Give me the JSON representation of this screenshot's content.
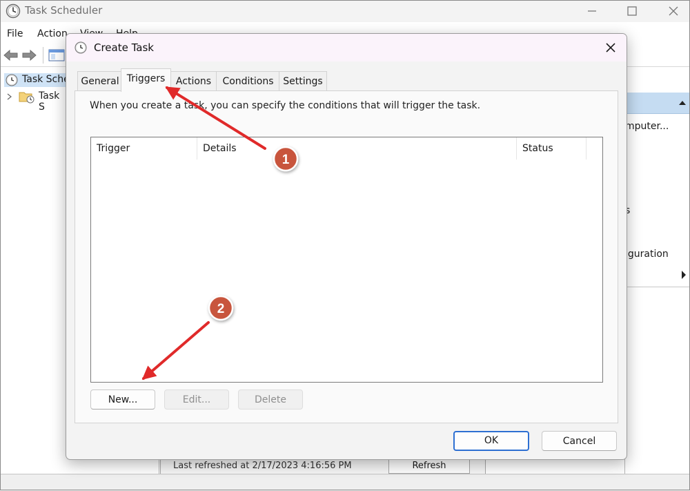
{
  "main_window": {
    "title": "Task Scheduler",
    "menu": {
      "file": "File",
      "action": "Action",
      "view": "View",
      "help": "Help"
    },
    "tree": {
      "root_label": "Task Sche",
      "child_label": "Task S"
    },
    "actions_panel": {
      "item_computer": "mputer...",
      "item_tasks": "s",
      "item_configuration": "iguration"
    },
    "bottom_text": "Last refreshed at 2/17/2023 4:16:56 PM",
    "refresh_label": "Refresh"
  },
  "dialog": {
    "title": "Create Task",
    "tabs": [
      {
        "label": "General"
      },
      {
        "label": "Triggers"
      },
      {
        "label": "Actions"
      },
      {
        "label": "Conditions"
      },
      {
        "label": "Settings"
      }
    ],
    "active_tab": "Triggers",
    "instruction": "When you create a task, you can specify the conditions that will trigger the task.",
    "list_columns": [
      "Trigger",
      "Details",
      "Status"
    ],
    "list_rows": [],
    "buttons": {
      "new": "New...",
      "edit": "Edit...",
      "delete": "Delete"
    },
    "ok_label": "OK",
    "cancel_label": "Cancel"
  },
  "annotations": [
    {
      "number": "1",
      "target": "Triggers tab"
    },
    {
      "number": "2",
      "target": "New... button"
    }
  ],
  "colors": {
    "annotation_red": "#e02a2a",
    "badge_fill": "#c8553d",
    "ok_border": "#2d6fd2",
    "selection_blue": "#cfe3f6"
  }
}
